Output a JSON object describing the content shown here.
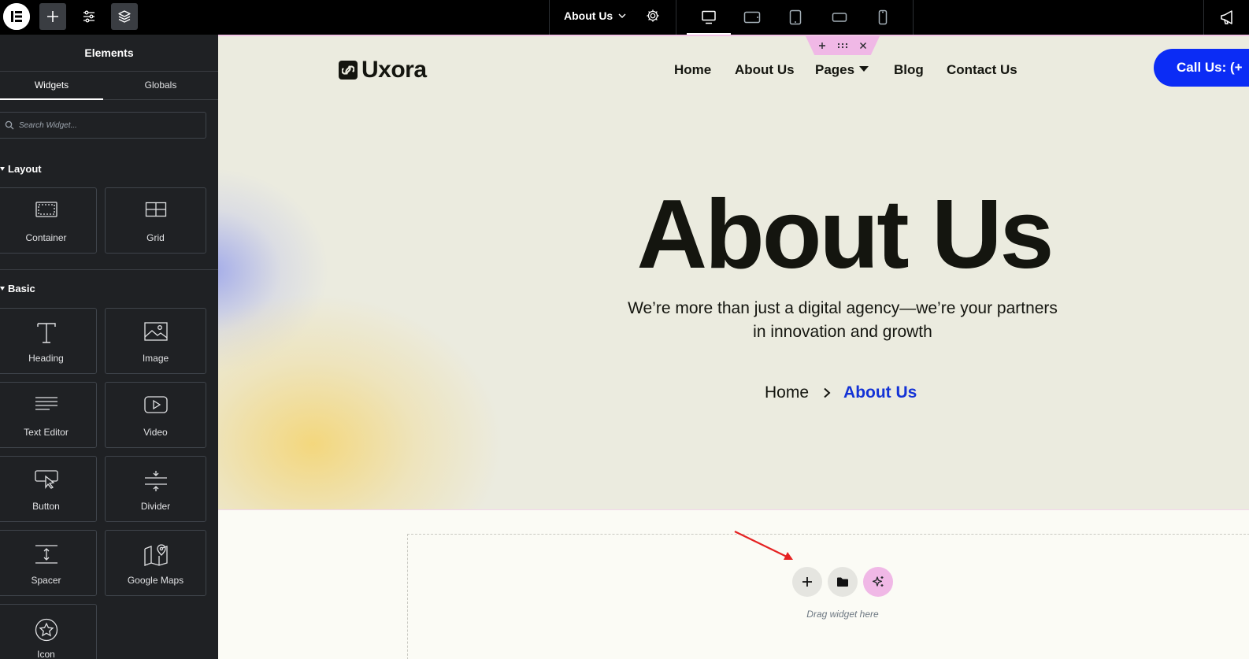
{
  "topbar": {
    "page_title": "About Us",
    "icons": {
      "logo": "elementor-logo-icon",
      "add": "plus-icon",
      "settings": "sliders-icon",
      "structure": "layers-icon",
      "page_settings": "gear-icon",
      "announcements": "megaphone-icon"
    },
    "devices": [
      "desktop",
      "tablet-landscape",
      "tablet-portrait",
      "mobile-landscape",
      "mobile-portrait"
    ],
    "active_device": "desktop"
  },
  "sidebar": {
    "title": "Elements",
    "tabs": [
      {
        "label": "Widgets",
        "active": true
      },
      {
        "label": "Globals",
        "active": false
      }
    ],
    "search": {
      "placeholder": "Search Widget...",
      "value": ""
    },
    "categories": [
      {
        "label": "Layout",
        "widgets": [
          {
            "label": "Container",
            "icon": "container-icon"
          },
          {
            "label": "Grid",
            "icon": "grid-icon"
          }
        ]
      },
      {
        "label": "Basic",
        "widgets": [
          {
            "label": "Heading",
            "icon": "heading-icon"
          },
          {
            "label": "Image",
            "icon": "image-icon"
          },
          {
            "label": "Text Editor",
            "icon": "text-editor-icon"
          },
          {
            "label": "Video",
            "icon": "video-icon"
          },
          {
            "label": "Button",
            "icon": "button-icon"
          },
          {
            "label": "Divider",
            "icon": "divider-icon"
          },
          {
            "label": "Spacer",
            "icon": "spacer-icon"
          },
          {
            "label": "Google Maps",
            "icon": "google-maps-icon"
          },
          {
            "label": "Icon",
            "icon": "star-icon"
          }
        ]
      }
    ]
  },
  "site": {
    "logo_text": "Uxora",
    "nav": [
      "Home",
      "About Us",
      "Pages",
      "Blog",
      "Contact Us"
    ],
    "cta_label": "Call Us: (+",
    "hero": {
      "title": "About Us",
      "subtitle_line1": "We’re more than just a digital agency—we’re your partners",
      "subtitle_line2": "in innovation and growth",
      "breadcrumb": [
        "Home",
        "About Us"
      ]
    }
  },
  "dropzone": {
    "hint": "Drag widget here"
  },
  "colors": {
    "accent_blue": "#0b2cf5",
    "breadcrumb_current": "#1433d6",
    "editor_pink": "#f0b8e6",
    "annotation": "#e52222"
  }
}
